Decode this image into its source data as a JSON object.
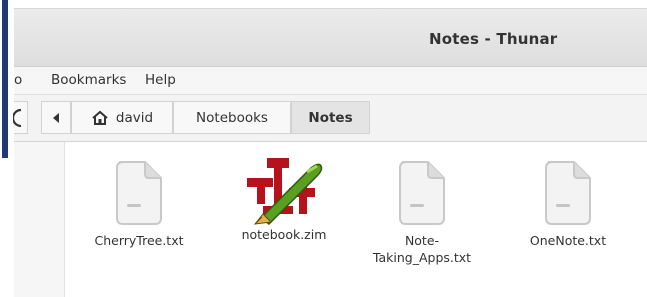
{
  "window": {
    "title": "Notes - Thunar"
  },
  "menu": {
    "items": [
      "o",
      "Bookmarks",
      "Help"
    ]
  },
  "pathbar": {
    "crumbs": [
      {
        "label": "david"
      },
      {
        "label": "Notebooks"
      },
      {
        "label": "Notes"
      }
    ],
    "back_icon": "chevron-left-icon",
    "home_icon": "home-icon"
  },
  "files": [
    {
      "name": "CherryTree.txt",
      "icon": "text-document-icon"
    },
    {
      "name": "notebook.zim",
      "icon": "zim-pen-icon"
    },
    {
      "name": "Note-\nTaking_Apps.txt",
      "icon": "text-document-icon"
    },
    {
      "name": "OneNote.txt",
      "icon": "text-document-icon"
    }
  ],
  "colors": {
    "accent_strip": "#1f3b73"
  }
}
